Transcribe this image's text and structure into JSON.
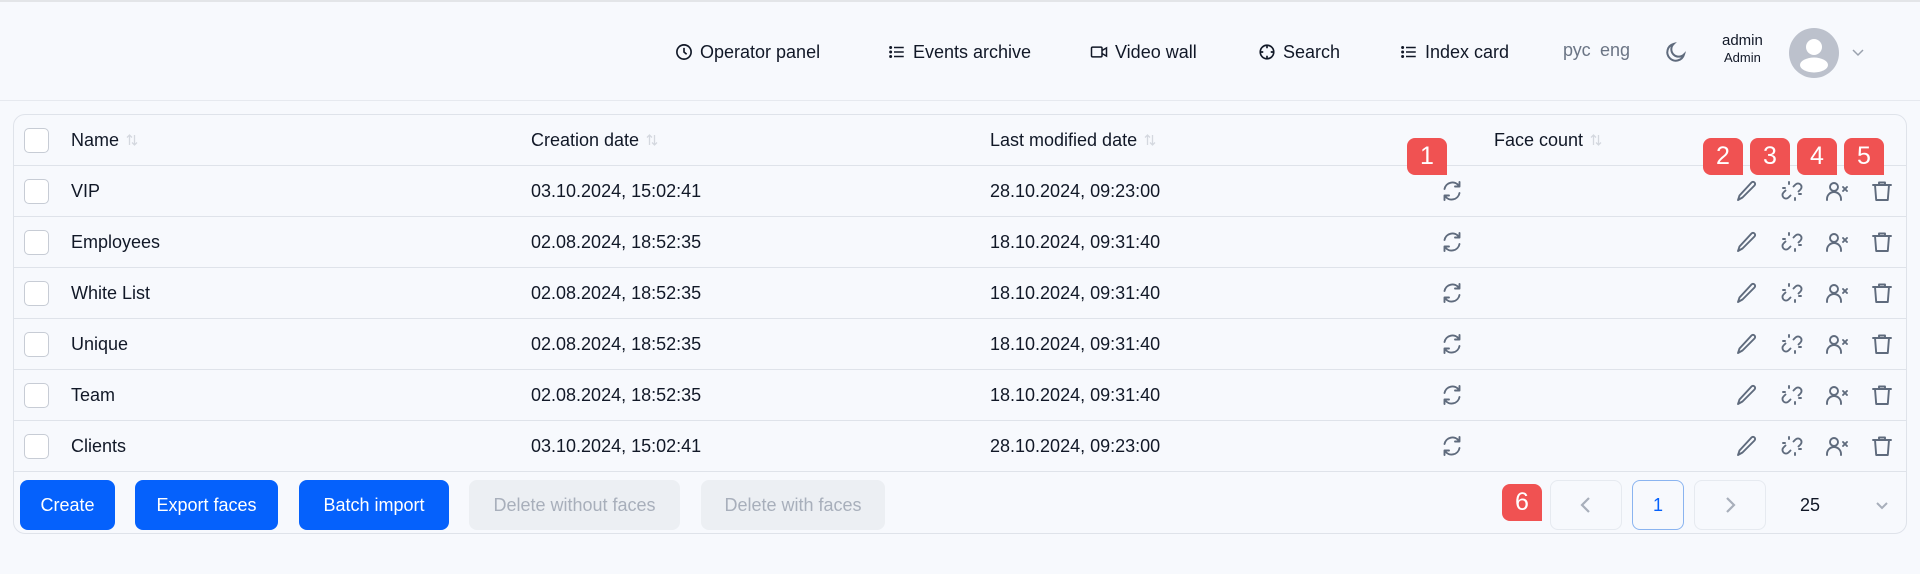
{
  "header": {
    "nav": [
      {
        "label": "Operator panel",
        "icon": "clock-icon"
      },
      {
        "label": "Events archive",
        "icon": "list-icon"
      },
      {
        "label": "Video wall",
        "icon": "video-camera-icon"
      },
      {
        "label": "Search",
        "icon": "crosshair-icon"
      },
      {
        "label": "Index card",
        "icon": "list-icon"
      }
    ],
    "languages": [
      "рус",
      "eng"
    ],
    "theme_icon": "moon-icon",
    "user": {
      "login": "admin",
      "role": "Admin"
    }
  },
  "table": {
    "columns": [
      "Name",
      "Creation date",
      "Last modified date",
      "Face count"
    ],
    "rows": [
      {
        "name": "VIP",
        "created": "03.10.2024, 15:02:41",
        "modified": "28.10.2024, 09:23:00",
        "face_count": ""
      },
      {
        "name": "Employees",
        "created": "02.08.2024, 18:52:35",
        "modified": "18.10.2024, 09:31:40",
        "face_count": ""
      },
      {
        "name": "White List",
        "created": "02.08.2024, 18:52:35",
        "modified": "18.10.2024, 09:31:40",
        "face_count": ""
      },
      {
        "name": "Unique",
        "created": "02.08.2024, 18:52:35",
        "modified": "18.10.2024, 09:31:40",
        "face_count": ""
      },
      {
        "name": "Team",
        "created": "02.08.2024, 18:52:35",
        "modified": "18.10.2024, 09:31:40",
        "face_count": ""
      },
      {
        "name": "Clients",
        "created": "03.10.2024, 15:02:41",
        "modified": "28.10.2024, 09:23:00",
        "face_count": ""
      }
    ],
    "row_actions": [
      "refresh-icon",
      "pencil-icon",
      "unlink-icon",
      "user-remove-icon",
      "trash-icon"
    ]
  },
  "annotations": [
    "1",
    "2",
    "3",
    "4",
    "5",
    "6"
  ],
  "footer": {
    "buttons": [
      {
        "label": "Create",
        "enabled": true
      },
      {
        "label": "Export faces",
        "enabled": true
      },
      {
        "label": "Batch import",
        "enabled": true
      },
      {
        "label": "Delete without faces",
        "enabled": false
      },
      {
        "label": "Delete with faces",
        "enabled": false
      }
    ],
    "pagination": {
      "current_page": "1",
      "page_size": "25"
    }
  },
  "colors": {
    "primary": "#0561fc",
    "badge": "#f05252",
    "icon": "#5f6b7d"
  }
}
